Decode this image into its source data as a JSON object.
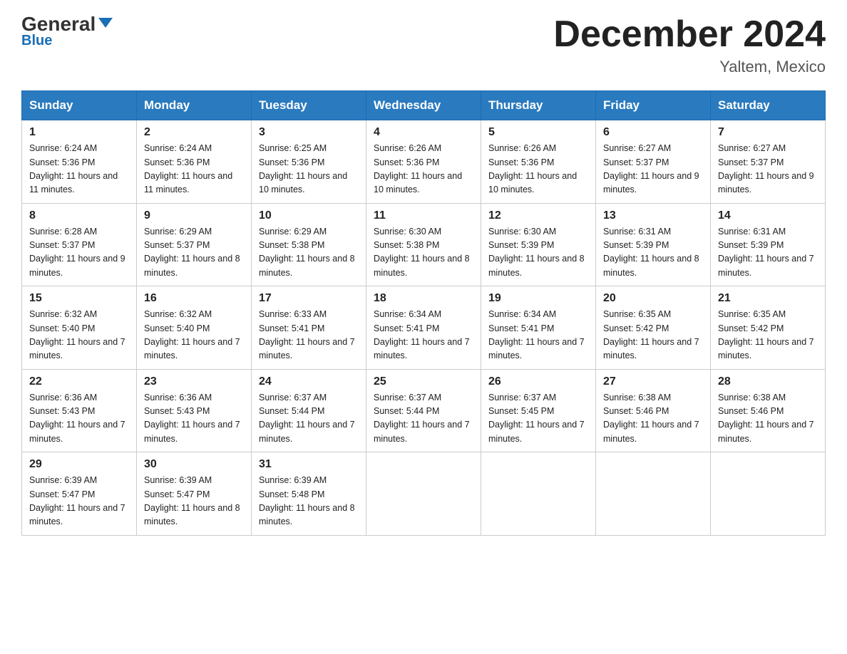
{
  "header": {
    "logo_general": "General",
    "logo_blue": "Blue",
    "month_title": "December 2024",
    "location": "Yaltem, Mexico"
  },
  "weekdays": [
    "Sunday",
    "Monday",
    "Tuesday",
    "Wednesday",
    "Thursday",
    "Friday",
    "Saturday"
  ],
  "weeks": [
    [
      {
        "day": "1",
        "sunrise": "6:24 AM",
        "sunset": "5:36 PM",
        "daylight": "11 hours and 11 minutes."
      },
      {
        "day": "2",
        "sunrise": "6:24 AM",
        "sunset": "5:36 PM",
        "daylight": "11 hours and 11 minutes."
      },
      {
        "day": "3",
        "sunrise": "6:25 AM",
        "sunset": "5:36 PM",
        "daylight": "11 hours and 10 minutes."
      },
      {
        "day": "4",
        "sunrise": "6:26 AM",
        "sunset": "5:36 PM",
        "daylight": "11 hours and 10 minutes."
      },
      {
        "day": "5",
        "sunrise": "6:26 AM",
        "sunset": "5:36 PM",
        "daylight": "11 hours and 10 minutes."
      },
      {
        "day": "6",
        "sunrise": "6:27 AM",
        "sunset": "5:37 PM",
        "daylight": "11 hours and 9 minutes."
      },
      {
        "day": "7",
        "sunrise": "6:27 AM",
        "sunset": "5:37 PM",
        "daylight": "11 hours and 9 minutes."
      }
    ],
    [
      {
        "day": "8",
        "sunrise": "6:28 AM",
        "sunset": "5:37 PM",
        "daylight": "11 hours and 9 minutes."
      },
      {
        "day": "9",
        "sunrise": "6:29 AM",
        "sunset": "5:37 PM",
        "daylight": "11 hours and 8 minutes."
      },
      {
        "day": "10",
        "sunrise": "6:29 AM",
        "sunset": "5:38 PM",
        "daylight": "11 hours and 8 minutes."
      },
      {
        "day": "11",
        "sunrise": "6:30 AM",
        "sunset": "5:38 PM",
        "daylight": "11 hours and 8 minutes."
      },
      {
        "day": "12",
        "sunrise": "6:30 AM",
        "sunset": "5:39 PM",
        "daylight": "11 hours and 8 minutes."
      },
      {
        "day": "13",
        "sunrise": "6:31 AM",
        "sunset": "5:39 PM",
        "daylight": "11 hours and 8 minutes."
      },
      {
        "day": "14",
        "sunrise": "6:31 AM",
        "sunset": "5:39 PM",
        "daylight": "11 hours and 7 minutes."
      }
    ],
    [
      {
        "day": "15",
        "sunrise": "6:32 AM",
        "sunset": "5:40 PM",
        "daylight": "11 hours and 7 minutes."
      },
      {
        "day": "16",
        "sunrise": "6:32 AM",
        "sunset": "5:40 PM",
        "daylight": "11 hours and 7 minutes."
      },
      {
        "day": "17",
        "sunrise": "6:33 AM",
        "sunset": "5:41 PM",
        "daylight": "11 hours and 7 minutes."
      },
      {
        "day": "18",
        "sunrise": "6:34 AM",
        "sunset": "5:41 PM",
        "daylight": "11 hours and 7 minutes."
      },
      {
        "day": "19",
        "sunrise": "6:34 AM",
        "sunset": "5:41 PM",
        "daylight": "11 hours and 7 minutes."
      },
      {
        "day": "20",
        "sunrise": "6:35 AM",
        "sunset": "5:42 PM",
        "daylight": "11 hours and 7 minutes."
      },
      {
        "day": "21",
        "sunrise": "6:35 AM",
        "sunset": "5:42 PM",
        "daylight": "11 hours and 7 minutes."
      }
    ],
    [
      {
        "day": "22",
        "sunrise": "6:36 AM",
        "sunset": "5:43 PM",
        "daylight": "11 hours and 7 minutes."
      },
      {
        "day": "23",
        "sunrise": "6:36 AM",
        "sunset": "5:43 PM",
        "daylight": "11 hours and 7 minutes."
      },
      {
        "day": "24",
        "sunrise": "6:37 AM",
        "sunset": "5:44 PM",
        "daylight": "11 hours and 7 minutes."
      },
      {
        "day": "25",
        "sunrise": "6:37 AM",
        "sunset": "5:44 PM",
        "daylight": "11 hours and 7 minutes."
      },
      {
        "day": "26",
        "sunrise": "6:37 AM",
        "sunset": "5:45 PM",
        "daylight": "11 hours and 7 minutes."
      },
      {
        "day": "27",
        "sunrise": "6:38 AM",
        "sunset": "5:46 PM",
        "daylight": "11 hours and 7 minutes."
      },
      {
        "day": "28",
        "sunrise": "6:38 AM",
        "sunset": "5:46 PM",
        "daylight": "11 hours and 7 minutes."
      }
    ],
    [
      {
        "day": "29",
        "sunrise": "6:39 AM",
        "sunset": "5:47 PM",
        "daylight": "11 hours and 7 minutes."
      },
      {
        "day": "30",
        "sunrise": "6:39 AM",
        "sunset": "5:47 PM",
        "daylight": "11 hours and 8 minutes."
      },
      {
        "day": "31",
        "sunrise": "6:39 AM",
        "sunset": "5:48 PM",
        "daylight": "11 hours and 8 minutes."
      },
      null,
      null,
      null,
      null
    ]
  ]
}
